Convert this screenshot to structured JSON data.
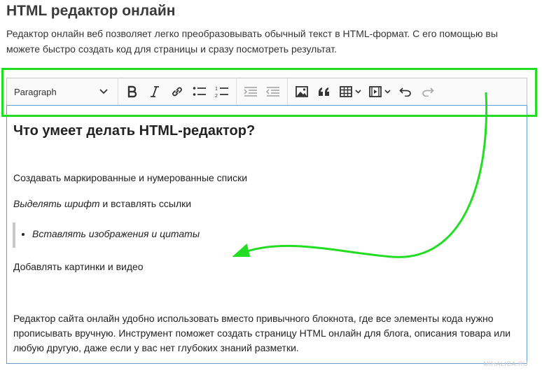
{
  "page": {
    "title": "HTML редактор онлайн",
    "description": "Редактор онлайн веб позволяет легко преобразовывать обычный текст в HTML-формат. С его помощью вы можете быстро создать код для страницы и сразу посмотреть результат."
  },
  "toolbar": {
    "format_select": "Paragraph",
    "icons": [
      "chevron-down-icon",
      "bold-icon",
      "italic-icon",
      "link-icon",
      "bulleted-list-icon",
      "numbered-list-icon",
      "indent-icon",
      "outdent-icon",
      "image-icon",
      "quote-icon",
      "table-icon",
      "media-icon",
      "undo-icon",
      "redo-icon"
    ]
  },
  "editor": {
    "heading": "Что умеет делать HTML-редактор?",
    "line1": "Создавать маркированные и нумерованные списки",
    "line2_italic": "Выделять шрифт",
    "line2_rest": " и вставлять ссылки",
    "quote_item": "Вставлять изображения и цитаты",
    "line3": "Добавлять картинки и видео",
    "paragraph": "Редактор сайта онлайн удобно использовать вместо привычного блокнота, где все элементы кода нужно прописывать вручную. Инструмент поможет создать страницу HTML онлайн для блога, описания товара или любую другую, даже если у вас нет глубоких знаний разметки."
  },
  "annotation": {
    "color": "#22dd22"
  },
  "watermark": "MIHALICA.RU"
}
